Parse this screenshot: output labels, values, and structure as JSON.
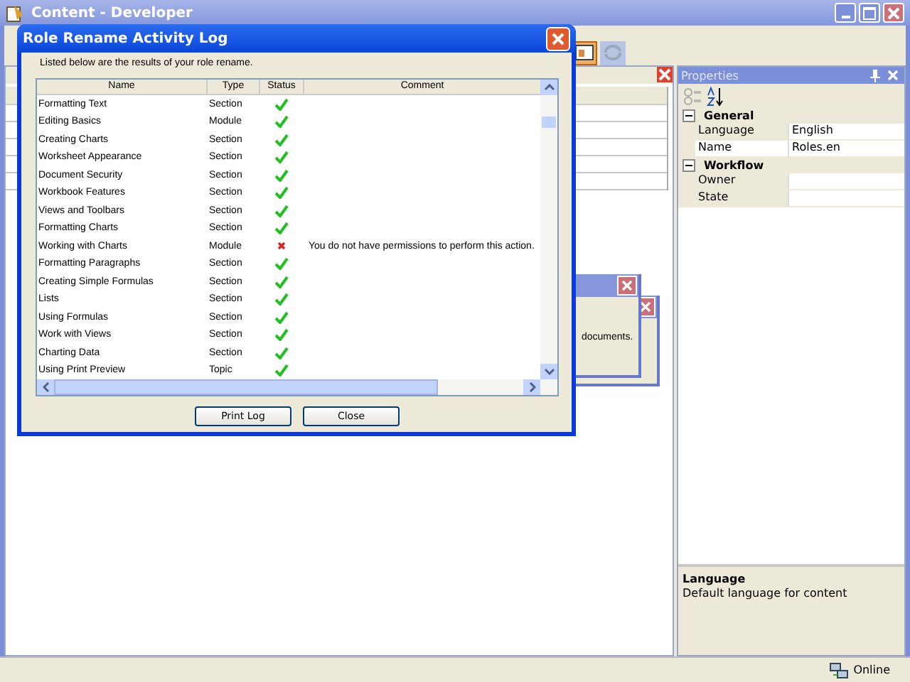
{
  "window": {
    "title": "Content - Developer"
  },
  "dialog": {
    "title": "Role Rename Activity Log",
    "intro": "Listed below are the results of your role rename.",
    "columns": [
      "Name",
      "Type",
      "Status",
      "Comment"
    ],
    "rows": [
      {
        "name": "Formatting Text",
        "type": "Section",
        "success": true
      },
      {
        "name": "Editing Basics",
        "type": "Module",
        "success": true
      },
      {
        "name": "Creating Charts",
        "type": "Section",
        "success": true
      },
      {
        "name": "Worksheet Appearance",
        "type": "Section",
        "success": true
      },
      {
        "name": "Document Security",
        "type": "Section",
        "success": true
      },
      {
        "name": "Workbook Features",
        "type": "Section",
        "success": true
      },
      {
        "name": "Views and Toolbars",
        "type": "Section",
        "success": true
      },
      {
        "name": "Formatting Charts",
        "type": "Section",
        "success": true
      },
      {
        "name": "Working with Charts",
        "type": "Module",
        "success": false,
        "comment": "You do not have permissions to perform this action."
      },
      {
        "name": "Formatting Paragraphs",
        "type": "Section",
        "success": true
      },
      {
        "name": "Creating Simple Formulas",
        "type": "Section",
        "success": true
      },
      {
        "name": "Lists",
        "type": "Section",
        "success": true
      },
      {
        "name": "Using Formulas",
        "type": "Section",
        "success": true
      },
      {
        "name": "Work with Views",
        "type": "Section",
        "success": true
      },
      {
        "name": "Charting Data",
        "type": "Section",
        "success": true
      },
      {
        "name": "Using Print Preview",
        "type": "Topic",
        "success": true
      }
    ],
    "buttons": [
      "Print Log",
      "Close"
    ]
  },
  "back_dialog": {
    "text": "documents."
  },
  "properties": {
    "title": "Properties",
    "groups": [
      {
        "name": "General",
        "expanded": true,
        "items": [
          {
            "label": "Language",
            "value": "English",
            "selected": false
          },
          {
            "label": "Name",
            "value": "Roles.en",
            "selected": true
          }
        ]
      },
      {
        "name": "Workflow",
        "expanded": true,
        "items": [
          {
            "label": "Owner",
            "selected": false
          },
          {
            "label": "State",
            "selected": false
          }
        ]
      }
    ],
    "description": {
      "title": "Language",
      "text": "Default language for content"
    }
  },
  "status_bar": {
    "text": "Online"
  }
}
